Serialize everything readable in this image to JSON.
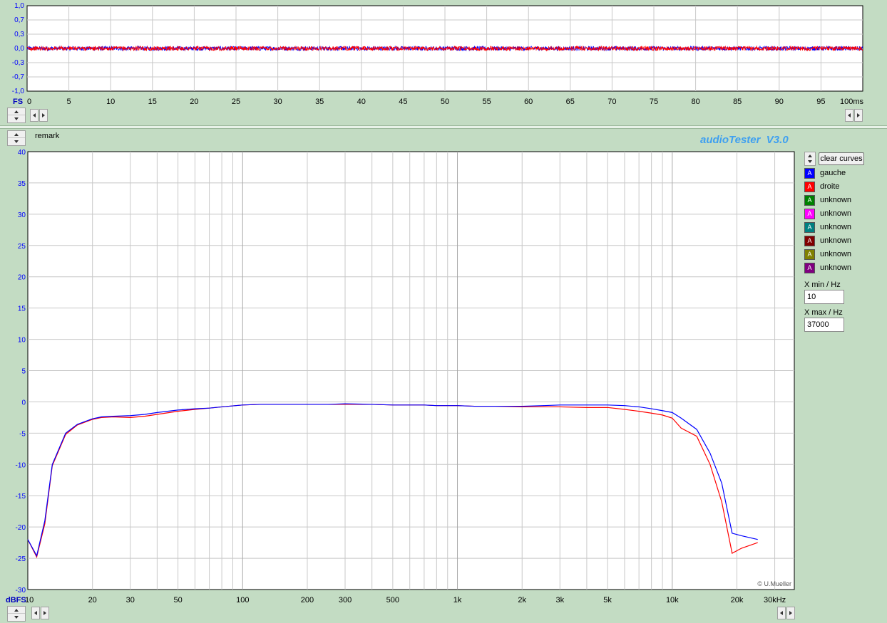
{
  "top_panel": {
    "y_ticks": [
      "1,0",
      "0,7",
      "0,3",
      "0,0",
      "-0,3",
      "-0,7",
      "-1,0"
    ],
    "x_unit_left": "FS",
    "x_ticks": [
      "0",
      "5",
      "10",
      "15",
      "20",
      "25",
      "30",
      "35",
      "40",
      "45",
      "50",
      "55",
      "60",
      "65",
      "70",
      "75",
      "80",
      "85",
      "90",
      "95",
      "100ms"
    ]
  },
  "header": {
    "remark_label": "remark",
    "app_title": "audioTester  V3.0"
  },
  "main_chart": {
    "y_unit": "dBFS",
    "y_ticks": [
      "40",
      "35",
      "30",
      "25",
      "20",
      "15",
      "10",
      "5",
      "0",
      "-5",
      "-10",
      "-15",
      "-20",
      "-25",
      "-30"
    ],
    "x_ticks": [
      "10",
      "20",
      "30",
      "50",
      "100",
      "200",
      "300",
      "500",
      "1k",
      "2k",
      "3k",
      "5k",
      "10k",
      "20k",
      "30kHz"
    ],
    "copyright": "© U.Mueller"
  },
  "right_panel": {
    "clear_button": "clear curves",
    "legend": [
      {
        "label": "gauche",
        "color": "#0000ff"
      },
      {
        "label": "droite",
        "color": "#ff0000"
      },
      {
        "label": "unknown",
        "color": "#008000"
      },
      {
        "label": "unknown",
        "color": "#ff00ff"
      },
      {
        "label": "unknown",
        "color": "#008080"
      },
      {
        "label": "unknown",
        "color": "#800000"
      },
      {
        "label": "unknown",
        "color": "#808000"
      },
      {
        "label": "unknown",
        "color": "#800080"
      }
    ],
    "legend_glyph": "A",
    "xmin_label": "X min / Hz",
    "xmin_value": "10",
    "xmax_label": "X max / Hz",
    "xmax_value": "37000"
  },
  "chart_data": [
    {
      "type": "line",
      "x": [
        0,
        100
      ],
      "xlim": [
        0,
        100
      ],
      "ylim": [
        -1,
        1
      ],
      "series": [
        {
          "name": "gauche",
          "color": "#0000ff",
          "y": [
            0.0,
            0.0
          ],
          "amplitude": 0.05
        },
        {
          "name": "droite",
          "color": "#ff0000",
          "y": [
            0.0,
            0.0
          ],
          "amplitude": 0.05
        }
      ]
    },
    {
      "type": "line",
      "xscale": "log",
      "xlim": [
        10,
        37000
      ],
      "ylim": [
        -30,
        40
      ],
      "ylabel": "dBFS",
      "grid": true,
      "series": [
        {
          "name": "gauche",
          "color": "#0000ff",
          "x": [
            10,
            11,
            12,
            13,
            15,
            17,
            20,
            22,
            25,
            30,
            35,
            40,
            50,
            60,
            70,
            80,
            100,
            120,
            150,
            200,
            250,
            300,
            400,
            500,
            600,
            700,
            800,
            1000,
            1200,
            1500,
            2000,
            2500,
            3000,
            4000,
            5000,
            6000,
            7000,
            8000,
            9000,
            10000,
            11000,
            13000,
            15000,
            17000,
            19000,
            21000,
            25000
          ],
          "y": [
            -22,
            -24.6,
            -19,
            -10,
            -5,
            -3.6,
            -2.7,
            -2.4,
            -2.3,
            -2.2,
            -2.0,
            -1.7,
            -1.3,
            -1.1,
            -1.0,
            -0.8,
            -0.5,
            -0.4,
            -0.4,
            -0.4,
            -0.4,
            -0.3,
            -0.4,
            -0.5,
            -0.5,
            -0.5,
            -0.6,
            -0.6,
            -0.7,
            -0.7,
            -0.7,
            -0.6,
            -0.5,
            -0.5,
            -0.5,
            -0.6,
            -0.8,
            -1.1,
            -1.4,
            -1.7,
            -2.6,
            -4.4,
            -8.2,
            -13,
            -21,
            -21.4,
            -22
          ]
        },
        {
          "name": "droite",
          "color": "#ff0000",
          "x": [
            10,
            11,
            12,
            13,
            15,
            17,
            20,
            22,
            25,
            30,
            35,
            40,
            50,
            60,
            70,
            80,
            100,
            120,
            150,
            200,
            250,
            300,
            400,
            500,
            600,
            700,
            800,
            1000,
            1200,
            1500,
            2000,
            2500,
            3000,
            4000,
            5000,
            6000,
            7000,
            8000,
            9000,
            10000,
            11000,
            13000,
            15000,
            17000,
            19000,
            21000,
            25000
          ],
          "y": [
            -22,
            -24.8,
            -19.5,
            -10.2,
            -5.2,
            -3.7,
            -2.8,
            -2.5,
            -2.4,
            -2.5,
            -2.3,
            -2.0,
            -1.5,
            -1.2,
            -1.0,
            -0.8,
            -0.5,
            -0.4,
            -0.4,
            -0.4,
            -0.4,
            -0.4,
            -0.4,
            -0.5,
            -0.5,
            -0.5,
            -0.6,
            -0.6,
            -0.7,
            -0.7,
            -0.8,
            -0.8,
            -0.8,
            -0.9,
            -0.9,
            -1.2,
            -1.5,
            -1.8,
            -2.1,
            -2.6,
            -4.2,
            -5.5,
            -10,
            -16,
            -24.2,
            -23.4,
            -22.5
          ]
        }
      ]
    }
  ]
}
